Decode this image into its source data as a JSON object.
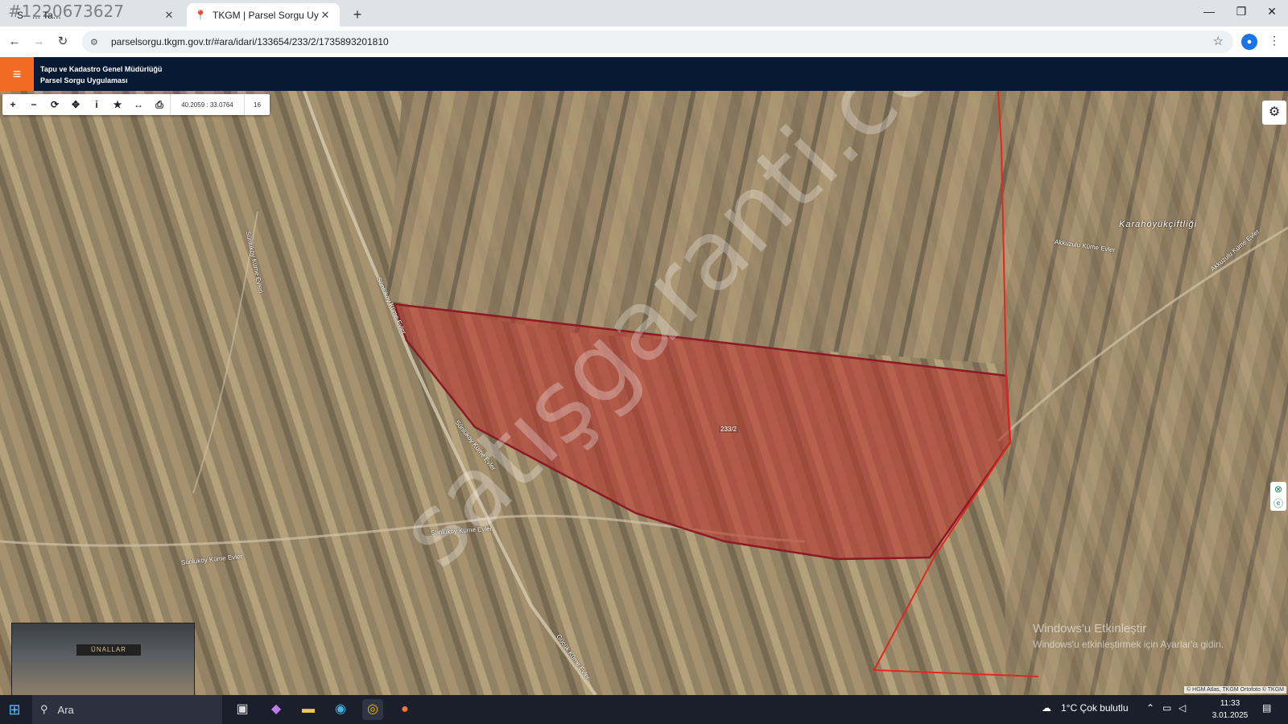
{
  "overlay_id": "#1220673627",
  "browser": {
    "tabs": [
      {
        "label": "... Ta...",
        "active": false
      },
      {
        "label": "TKGM | Parsel Sorgu Uygulaması",
        "active": true
      }
    ],
    "url": "parselsorgu.tkgm.gov.tr/#ara/idari/133654/233/2/1735893201810"
  },
  "app": {
    "title_line1": "Tapu ve Kadastro Genel Müdürlüğü",
    "title_line2": "Parsel Sorgu Uygulaması"
  },
  "map": {
    "coordinates": "40.2059 : 33.0764",
    "zoom": "16",
    "parcel_label": "233/2",
    "place_name": "Karahöyükçiftliği",
    "road_labels": [
      "Sünlüköy Küme Evleri",
      "Sünlüköy Küme Evler",
      "Sünlüköy Küme Evler",
      "Sünlüköy Küme Evler",
      "Akkuzulu Küme Evler",
      "Akkuzulu Küme Evler",
      "Gücük Küme Evler"
    ],
    "watermark": "satışgaranti.com",
    "windows_activation_title": "Windows'u Etkinleştir",
    "windows_activation_sub": "Windows'u etkinleştirmek için Ayarlar'a gidin.",
    "attribution": "© HGM Atlas, TKGM Ortofoto © TKGM",
    "thumbnail_sign": "ÜNALLAR",
    "parcel_color": "#8b1a24",
    "boundary_color": "#e0281e"
  },
  "taskbar": {
    "search_placeholder": "Ara",
    "weather": "1°C  Çok bulutlu",
    "time": "11:33",
    "date": "3.01.2025"
  }
}
